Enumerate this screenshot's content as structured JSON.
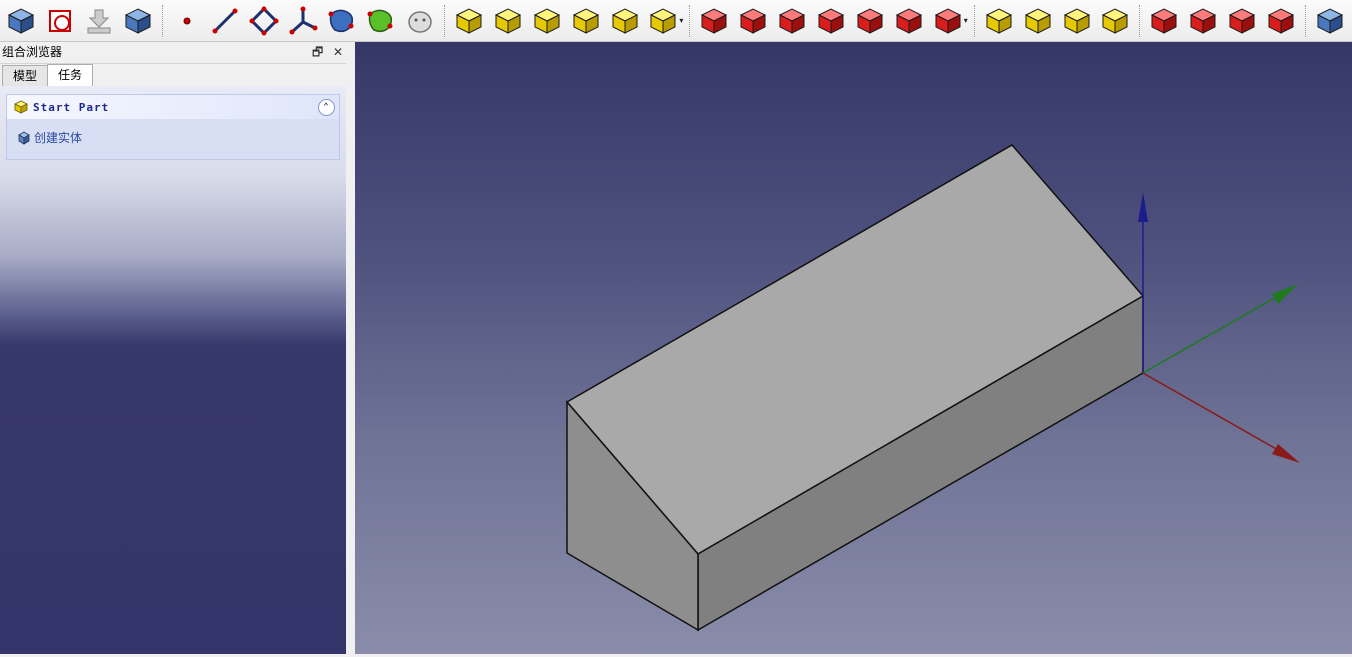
{
  "toolbar": {
    "items": [
      {
        "name": "part-body-icon",
        "type": "btn"
      },
      {
        "name": "create-sketch-icon",
        "type": "btn"
      },
      {
        "name": "leave-sketch-icon",
        "type": "btn"
      },
      {
        "name": "view-sketch-icon",
        "type": "btn"
      },
      {
        "type": "sep"
      },
      {
        "name": "datum-point-icon",
        "type": "btn"
      },
      {
        "name": "datum-line-icon",
        "type": "btn"
      },
      {
        "name": "datum-plane-icon",
        "type": "btn"
      },
      {
        "name": "local-coordinate-system-icon",
        "type": "btn"
      },
      {
        "name": "shape-binder-icon",
        "type": "btn"
      },
      {
        "name": "subshape-binder-icon",
        "type": "btn"
      },
      {
        "name": "clone-icon",
        "type": "btn"
      },
      {
        "type": "sep"
      },
      {
        "name": "pad-icon",
        "type": "btn"
      },
      {
        "name": "revolution-icon",
        "type": "btn"
      },
      {
        "name": "additive-loft-icon",
        "type": "btn"
      },
      {
        "name": "additive-pipe-icon",
        "type": "btn"
      },
      {
        "name": "additive-helix-icon",
        "type": "btn"
      },
      {
        "name": "additive-primitive-icon",
        "type": "btn",
        "dropdown": true
      },
      {
        "type": "sep"
      },
      {
        "name": "pocket-icon",
        "type": "btn"
      },
      {
        "name": "hole-icon",
        "type": "btn"
      },
      {
        "name": "groove-icon",
        "type": "btn"
      },
      {
        "name": "subtractive-loft-icon",
        "type": "btn"
      },
      {
        "name": "subtractive-pipe-icon",
        "type": "btn"
      },
      {
        "name": "subtractive-helix-icon",
        "type": "btn"
      },
      {
        "name": "subtractive-primitive-icon",
        "type": "btn",
        "dropdown": true
      },
      {
        "type": "sep"
      },
      {
        "name": "mirrored-icon",
        "type": "btn"
      },
      {
        "name": "linear-pattern-icon",
        "type": "btn"
      },
      {
        "name": "polar-pattern-icon",
        "type": "btn"
      },
      {
        "name": "multi-transform-icon",
        "type": "btn"
      },
      {
        "type": "sep"
      },
      {
        "name": "fillet-icon",
        "type": "btn"
      },
      {
        "name": "chamfer-icon",
        "type": "btn"
      },
      {
        "name": "draft-icon",
        "type": "btn"
      },
      {
        "name": "thickness-icon",
        "type": "btn"
      },
      {
        "type": "sep"
      },
      {
        "name": "boolean-icon",
        "type": "btn"
      }
    ],
    "dropdown_glyph": "▾"
  },
  "combo_view": {
    "title": "组合浏览器",
    "float_glyph": "🗗",
    "close_glyph": "✕",
    "tabs": [
      {
        "label": "模型",
        "active": false
      },
      {
        "label": "任务",
        "active": true
      }
    ]
  },
  "task_panel": {
    "header": "Start Part",
    "collapse_glyph": "⌃",
    "action_label": "创建实体"
  },
  "colors": {
    "x_axis": "#8b1a1a",
    "y_axis": "#1e7a1e",
    "z_axis": "#1c1c8c",
    "body_top": "#a9a9a9",
    "body_front": "#808080",
    "body_side": "#8e8e8e"
  }
}
